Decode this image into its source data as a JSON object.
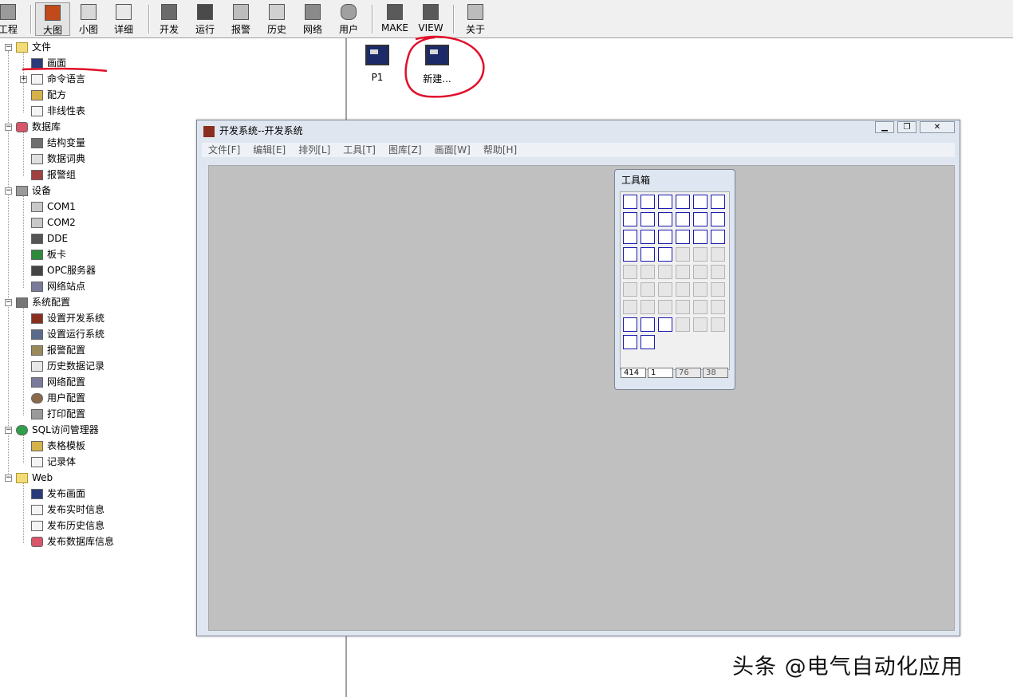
{
  "toolbar": {
    "items": [
      {
        "label": "工程",
        "icon": "project-icon"
      },
      {
        "label": "大图",
        "icon": "large-icons-icon",
        "active": true
      },
      {
        "label": "小图",
        "icon": "small-icons-icon"
      },
      {
        "label": "详细",
        "icon": "details-icon"
      },
      {
        "label": "开发",
        "icon": "develop-icon"
      },
      {
        "label": "运行",
        "icon": "run-icon"
      },
      {
        "label": "报警",
        "icon": "alarm-icon"
      },
      {
        "label": "历史",
        "icon": "history-icon"
      },
      {
        "label": "网络",
        "icon": "network-icon"
      },
      {
        "label": "用户",
        "icon": "user-key-icon"
      },
      {
        "label": "MAKE",
        "icon": "make-icon"
      },
      {
        "label": "VIEW",
        "icon": "view-icon"
      },
      {
        "label": "关于",
        "icon": "about-icon"
      }
    ]
  },
  "tree": {
    "wenjian": "文件",
    "huamian": "画面",
    "mingling": "命令语言",
    "peifang": "配方",
    "feixianxing": "非线性表",
    "shujuku": "数据库",
    "jiegou": "结构变量",
    "cidian": "数据词典",
    "baojingzu": "报警组",
    "shebei": "设备",
    "com1": "COM1",
    "com2": "COM2",
    "dde": "DDE",
    "banka": "板卡",
    "opc": "OPC服务器",
    "wangluozhandian": "网络站点",
    "xitongpeizhi": "系统配置",
    "shezhikaifa": "设置开发系统",
    "shezhiyunxing": "设置运行系统",
    "baojingpeizhi": "报警配置",
    "lishijilu": "历史数据记录",
    "wangluopeizhi": "网络配置",
    "yonghupeizhi": "用户配置",
    "dayinpeizhi": "打印配置",
    "sql": "SQL访问管理器",
    "biaogemuban": "表格模板",
    "jilut": "记录体",
    "web": "Web",
    "fabuhuamian": "发布画面",
    "fabushishi": "发布实时信息",
    "fabulishi": "发布历史信息",
    "fabushujuku": "发布数据库信息"
  },
  "files": [
    {
      "label": "P1"
    },
    {
      "label": "新建..."
    }
  ],
  "devwin": {
    "title": "开发系统--开发系统",
    "menu": [
      "文件[F]",
      "编辑[E]",
      "排列[L]",
      "工具[T]",
      "图库[Z]",
      "画面[W]",
      "帮助[H]"
    ]
  },
  "toolbox": {
    "title": "工具箱",
    "fields": [
      "414",
      "1",
      "76",
      "38"
    ]
  },
  "watermark": "头条 @电气自动化应用",
  "colors": {
    "annotation": "#e0102a",
    "canvas": "#c0c0c0",
    "window_frame": "#dfe6f0"
  }
}
